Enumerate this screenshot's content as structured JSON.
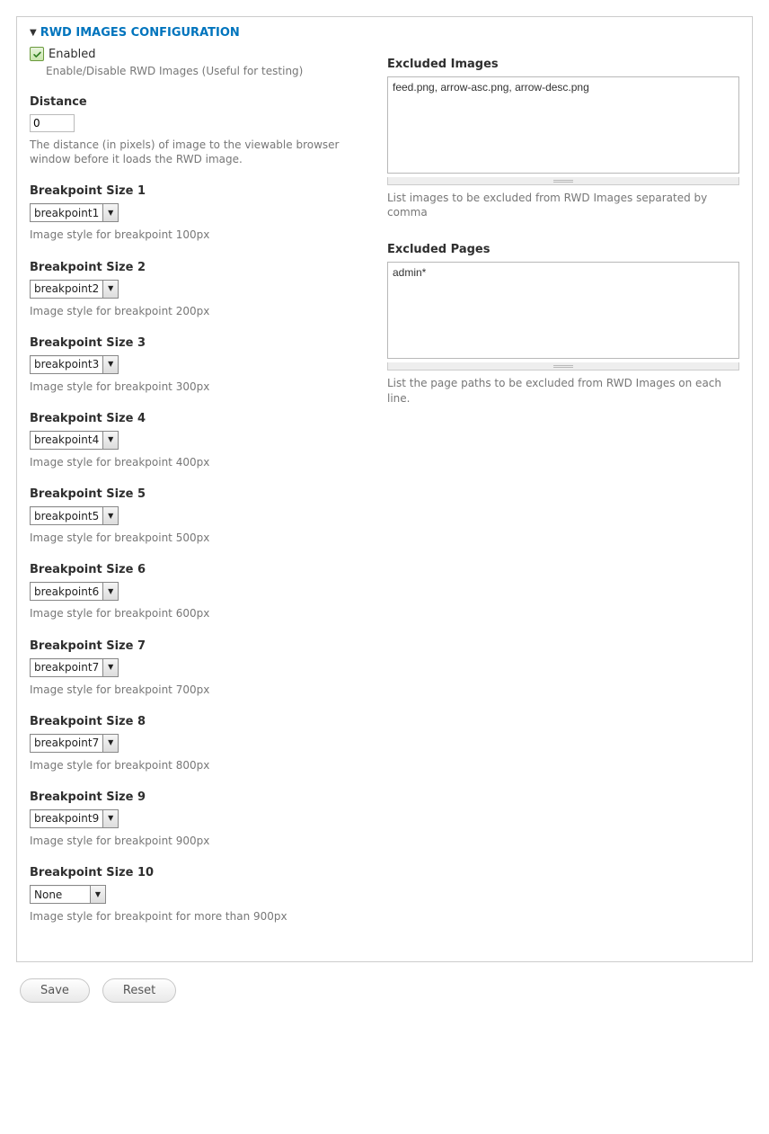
{
  "panel": {
    "title": "RWD IMAGES CONFIGURATION"
  },
  "enabled": {
    "label": "Enabled",
    "checked": true,
    "description": "Enable/Disable RWD Images (Useful for testing)"
  },
  "distance": {
    "label": "Distance",
    "value": "0",
    "description": "The distance (in pixels) of image to the viewable browser window before it loads the RWD image."
  },
  "breakpoints": [
    {
      "label": "Breakpoint Size 1",
      "value": "breakpoint1",
      "description": "Image style for breakpoint 100px"
    },
    {
      "label": "Breakpoint Size 2",
      "value": "breakpoint2",
      "description": "Image style for breakpoint 200px"
    },
    {
      "label": "Breakpoint Size 3",
      "value": "breakpoint3",
      "description": "Image style for breakpoint 300px"
    },
    {
      "label": "Breakpoint Size 4",
      "value": "breakpoint4",
      "description": "Image style for breakpoint 400px"
    },
    {
      "label": "Breakpoint Size 5",
      "value": "breakpoint5",
      "description": "Image style for breakpoint 500px"
    },
    {
      "label": "Breakpoint Size 6",
      "value": "breakpoint6",
      "description": "Image style for breakpoint 600px"
    },
    {
      "label": "Breakpoint Size 7",
      "value": "breakpoint7",
      "description": "Image style for breakpoint 700px"
    },
    {
      "label": "Breakpoint Size 8",
      "value": "breakpoint7",
      "description": "Image style for breakpoint 800px"
    },
    {
      "label": "Breakpoint Size 9",
      "value": "breakpoint9",
      "description": "Image style for breakpoint 900px"
    },
    {
      "label": "Breakpoint Size 10",
      "value": "None",
      "description": "Image style for breakpoint for more than 900px"
    }
  ],
  "excluded_images": {
    "label": "Excluded Images",
    "value": "feed.png, arrow-asc.png, arrow-desc.png",
    "description": "List images to be excluded from RWD Images separated by comma"
  },
  "excluded_pages": {
    "label": "Excluded Pages",
    "value": "admin*",
    "description": "List the page paths to be excluded from RWD Images on each line."
  },
  "actions": {
    "save": "Save",
    "reset": "Reset"
  }
}
